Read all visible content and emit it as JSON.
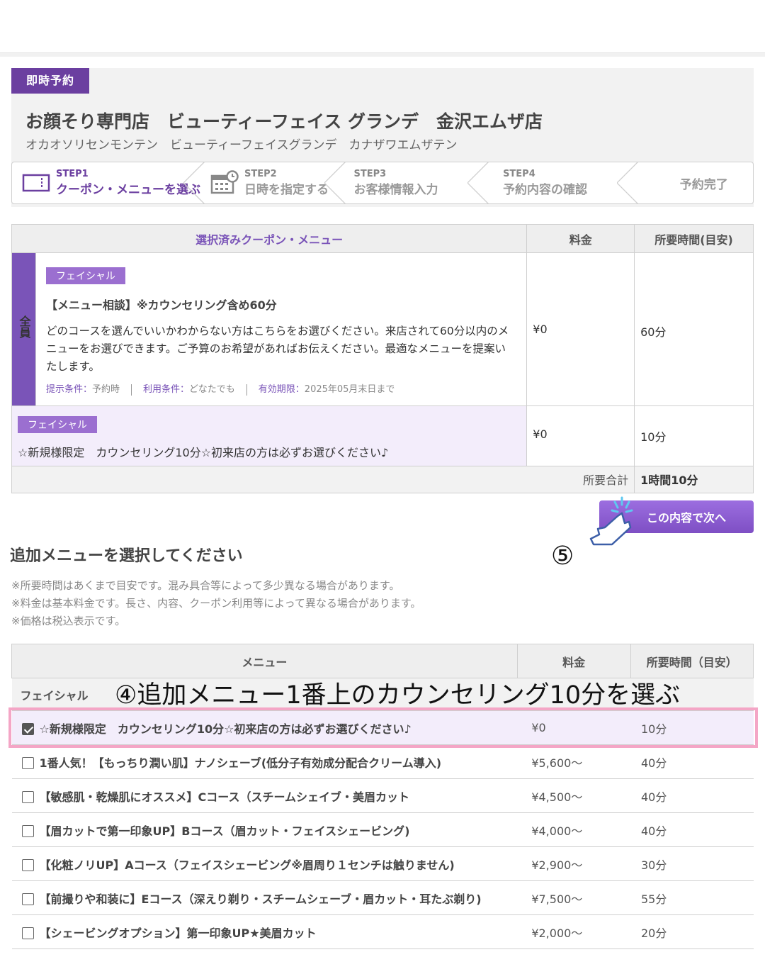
{
  "badge": "即時予約",
  "shop": {
    "name": "お顔そり専門店　ビューティーフェイス グランデ　金沢エムザ店",
    "kana": "オカオソリセンモンテン　ビューティーフェイスグランデ　カナザワエムザテン"
  },
  "steps": [
    {
      "num": "STEP1",
      "label": "クーポン・メニューを選ぶ",
      "icon": "coupon-icon",
      "active": true
    },
    {
      "num": "STEP2",
      "label": "日時を指定する",
      "icon": "calendar-clock-icon"
    },
    {
      "num": "STEP3",
      "label": "お客様情報入力"
    },
    {
      "num": "STEP4",
      "label": "予約内容の確認"
    },
    {
      "label": "予約完了"
    }
  ],
  "selected": {
    "headers": {
      "menu": "選択済みクーポン・メニュー",
      "price": "料金",
      "time": "所要時間(目安)"
    },
    "coupon": {
      "side": "全員",
      "category": "フェイシャル",
      "title": "【メニュー相談】※カウンセリング含め60分",
      "desc": "どのコースを選んでいいかわからない方はこちらをお選びください。来店されて60分以内のメニューをお選びできます。ご予算のお希望があればお伝えください。最適なメニューを提案いたします。",
      "cond1_k": "提示条件：",
      "cond1_v": "予約時",
      "cond2_k": "利用条件：",
      "cond2_v": "どなたでも",
      "cond3_k": "有効期限：",
      "cond3_v": "2025年05月末日まで",
      "price": "¥0",
      "time": "60分"
    },
    "menu2": {
      "category": "フェイシャル",
      "title": "☆新規様限定　カウンセリング10分☆初来店の方は必ずお選びください♪",
      "price": "¥0",
      "time": "10分"
    },
    "total_label": "所要合計",
    "total_value": "1時間10分"
  },
  "next_button": "この内容で次へ",
  "annotation_5": "⑤",
  "annotation_4": "④追加メニュー1番上のカウンセリング10分を選ぶ",
  "additional": {
    "title": "追加メニューを選択してください",
    "notes": [
      "※所要時間はあくまで目安です。混み具合等によって多少異なる場合があります。",
      "※料金は基本料金です。長さ、内容、クーポン利用等によって異なる場合があります。",
      "※価格は税込表示です。"
    ],
    "headers": {
      "menu": "メニュー",
      "price": "料金",
      "time": "所要時間（目安）"
    },
    "category": "フェイシャル",
    "items": [
      {
        "name": "☆新規様限定　カウンセリング10分☆初来店の方は必ずお選びください♪",
        "price": "¥0",
        "time": "10分",
        "checked": true
      },
      {
        "name": "1番人気！【もっちり潤い肌】ナノシェーブ(低分子有効成分配合クリーム導入)",
        "price": "¥5,600～",
        "time": "40分"
      },
      {
        "name": "【敏感肌・乾燥肌にオススメ】Cコース（スチームシェイブ・美眉カット",
        "price": "¥4,500～",
        "time": "40分"
      },
      {
        "name": "【眉カットで第一印象UP】Bコース（眉カット・フェイスシェービング)",
        "price": "¥4,000～",
        "time": "40分"
      },
      {
        "name": "【化粧ノリUP】Aコース（フェイスシェービング※眉周り１センチは触りません)",
        "price": "¥2,900～",
        "time": "30分"
      },
      {
        "name": "【前撮りや和装に】Eコース（深えり剃り・スチームシェーブ・眉カット・耳たぶ剃り)",
        "price": "¥7,500～",
        "time": "55分"
      },
      {
        "name": "【シェービングオプション】第一印象UP★美眉カット",
        "price": "¥2,000～",
        "time": "20分"
      }
    ]
  }
}
